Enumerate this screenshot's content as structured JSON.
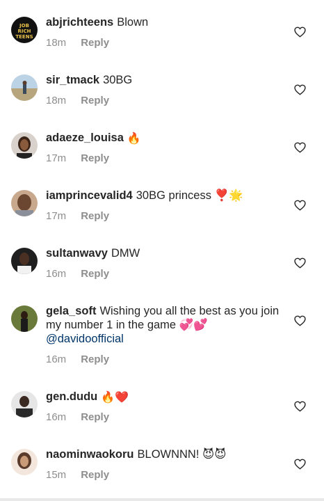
{
  "comments": [
    {
      "username": "abjrichteens",
      "text": "Blown",
      "time": "18m",
      "reply": "Reply",
      "avatar_text": "JOB RICH TEENS"
    },
    {
      "username": "sir_tmack",
      "text": "30BG",
      "time": "18m",
      "reply": "Reply"
    },
    {
      "username": "adaeze_louisa",
      "text": "🔥",
      "time": "17m",
      "reply": "Reply"
    },
    {
      "username": "iamprincevalid4",
      "text": "30BG princess ❣️🌟",
      "time": "17m",
      "reply": "Reply"
    },
    {
      "username": "sultanwavy",
      "text": "DMW",
      "time": "16m",
      "reply": "Reply"
    },
    {
      "username": "gela_soft",
      "text": "Wishing you all the best as you join my number 1 in the game 💞💕",
      "mention": "@davidoofficial",
      "time": "16m",
      "reply": "Reply"
    },
    {
      "username": "gen.dudu",
      "text": "🔥❤️",
      "time": "16m",
      "reply": "Reply"
    },
    {
      "username": "naominwaokoru",
      "text": "BLOWNNN! 😈😈",
      "time": "15m",
      "reply": "Reply"
    }
  ],
  "icons": {
    "like": "heart-outline-icon"
  },
  "colors": {
    "text": "#262626",
    "meta": "#8e8e8e",
    "mention": "#003569"
  }
}
